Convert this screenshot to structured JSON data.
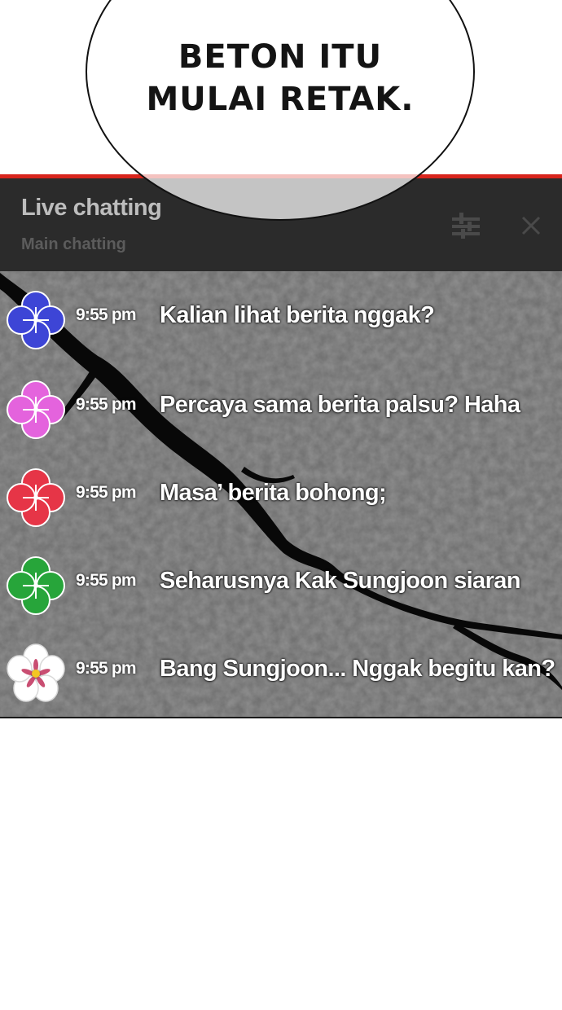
{
  "speech_bubble": {
    "line1": "BETON ITU",
    "line2": "MULAI RETAK."
  },
  "chat": {
    "title": "Live chatting",
    "subtitle": "Main chatting",
    "filter_icon": "sliders-icon",
    "close_icon": "close-icon",
    "accent_color": "#d8241c",
    "messages": [
      {
        "avatar": "blue-flower-avatar",
        "avatar_color": "#3d45d6",
        "time": "9:55 pm",
        "text": "Kalian lihat berita nggak?"
      },
      {
        "avatar": "pink-flower-avatar",
        "avatar_color": "#e463dd",
        "time": "9:55 pm",
        "text": "Percaya sama berita palsu? Haha"
      },
      {
        "avatar": "red-flower-avatar",
        "avatar_color": "#e63547",
        "time": "9:55 pm",
        "text": "Masa’ berita bohong;"
      },
      {
        "avatar": "green-flower-avatar",
        "avatar_color": "#27a53a",
        "time": "9:55 pm",
        "text": "Seharusnya Kak Sungjoon siaran"
      },
      {
        "avatar": "white-flower-avatar",
        "avatar_color": "#ffffff",
        "time": "9:55 pm",
        "text": "Bang Sungjoon... Nggak begitu kan?"
      }
    ]
  }
}
